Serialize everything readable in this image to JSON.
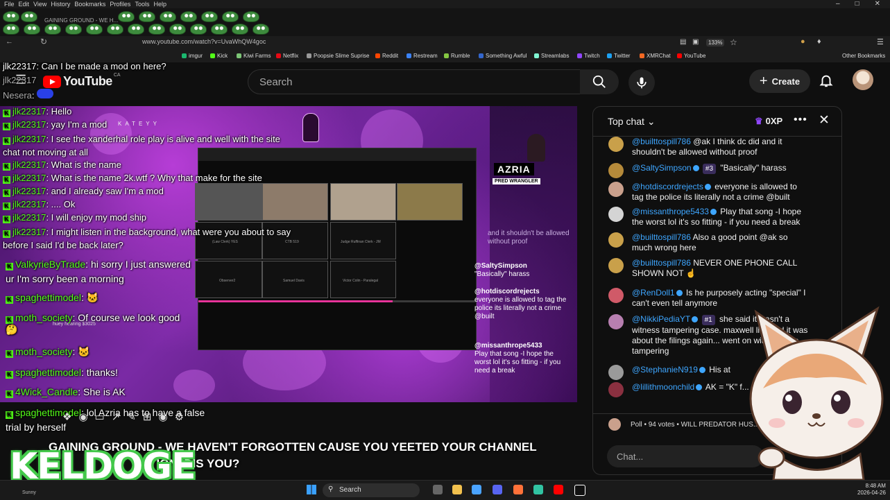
{
  "menubar": {
    "items": [
      "File",
      "Edit",
      "View",
      "History",
      "Bookmarks",
      "Profiles",
      "Tools",
      "Help"
    ]
  },
  "tabs": {
    "tab_title": "GAINING GROUND - WE H..."
  },
  "urlbar": {
    "url": "www.youtube.com/watch?v=UvaWhQW4goc",
    "zoom": "133%"
  },
  "bookmarks": [
    {
      "label": "imgur",
      "color": "#1bb76e"
    },
    {
      "label": "Kick",
      "color": "#53fc18"
    },
    {
      "label": "Kiwi Farms",
      "color": "#7cc576"
    },
    {
      "label": "Netflix",
      "color": "#e50914"
    },
    {
      "label": "Poopsie Slime Suprise",
      "color": "#999999"
    },
    {
      "label": "Reddit",
      "color": "#ff4500"
    },
    {
      "label": "Restream",
      "color": "#3b82f6"
    },
    {
      "label": "Rumble",
      "color": "#85c742"
    },
    {
      "label": "Something Awful",
      "color": "#3366cc"
    },
    {
      "label": "Streamlabs",
      "color": "#80f5d2"
    },
    {
      "label": "Twitch",
      "color": "#9146ff"
    },
    {
      "label": "Twitter",
      "color": "#1da1f2"
    },
    {
      "label": "XMRChat",
      "color": "#f26822"
    },
    {
      "label": "YouTube",
      "color": "#ff0000"
    }
  ],
  "other_bookmarks": "Other Bookmarks",
  "youtube": {
    "logo_text": "YouTube",
    "country": "CA",
    "search_placeholder": "Search",
    "create_label": "Create"
  },
  "video": {
    "azria": "AZRIA",
    "pred_tag": "PRED WRANGLER",
    "stream_title_fragment": "KATEYY",
    "mini_chat": [
      {
        "text": "and it shouldn't be allowed without proof"
      },
      {
        "author": "@SaltySimpson",
        "text": "\"Basically\" harass"
      },
      {
        "author": "@hotdiscordrejects",
        "text": "everyone is allowed to tag the police its literally not a crime @built"
      },
      {
        "author": "@missanthrope5433",
        "text": "Play that song -I hope the worst lol it's so fitting - if you need a break"
      }
    ],
    "thumb_labels": [
      "(Law Clerk) YES",
      "CTB 519",
      "Judge Ruffinan Clerk - JM",
      "Observer2",
      "Samuel Davis",
      "Victor Colin - Paralegal"
    ],
    "inner_overlay": "huey hearing $3025"
  },
  "overlay_chat": [
    {
      "user": "jlk22317",
      "text": "Can I be made a mod on here?"
    },
    {
      "user": "jlk22317",
      "text": ""
    },
    {
      "user": "Nesera",
      "text": ""
    },
    {
      "user": "jlk22317",
      "text": "Hello"
    },
    {
      "user": "jlk22317",
      "text": "yay I'm a mod"
    },
    {
      "user": "jlk22317",
      "text": "I see the xanderhal role play is alive and well with the site chat not moving at all"
    },
    {
      "user": "jlk22317",
      "text": "What is the name"
    },
    {
      "user": "jlk22317",
      "text": "What is the name 2k.wtf ? Why that make for the site"
    },
    {
      "user": "jlk22317",
      "text": "and I already saw I'm a mod"
    },
    {
      "user": "jlk22317",
      "text": ".... Ok"
    },
    {
      "user": "jlk22317",
      "text": "I will enjoy my mod ship"
    },
    {
      "user": "jlk22317",
      "text": "I might listen in the background, what were you about to say before I said I'd be back later?"
    }
  ],
  "overlay_chat_big": [
    {
      "user": "ValkyrieByTrade",
      "text": "hi sorry I just answered ur I'm sorry been a morning"
    },
    {
      "user": "spaghettimodel",
      "text": ""
    },
    {
      "user": "moth_society",
      "text": "Of course we look good"
    },
    {
      "user": "moth_society",
      "text": ""
    },
    {
      "user": "spaghettimodel",
      "text": "thanks!"
    },
    {
      "user": "4Wick_Candle",
      "text": "She is AK"
    },
    {
      "user": "spaghettimodel",
      "text": "lol Azria has to have a false trial by herself"
    }
  ],
  "banner": {
    "line1": "GAINING GROUND - WE HAVEN'T FORGOTTEN CAUSE YOU YEETED YOUR CHANNEL",
    "line2": "MATION, DIS YOU?"
  },
  "keldoge": "KELDOGE",
  "chat": {
    "header": "Top chat",
    "xp": "0XP",
    "messages": [
      {
        "author": "@builttospill786",
        "text": "@ak I think dc did and it shouldn't be allowed without proof",
        "avatar": "#c9a04a"
      },
      {
        "author": "@SaltySimpson",
        "rank": "#3",
        "text": "\"Basically\" harass",
        "avatar": "#b58a3a"
      },
      {
        "author": "@hotdiscordrejects",
        "text": "everyone is allowed to tag the police its literally not a crime @built",
        "avatar": "#caa08c"
      },
      {
        "author": "@missanthrope5433",
        "text": "Play that song -I hope the worst lol it's so fitting - if you need a break",
        "avatar": "#d4d4d4"
      },
      {
        "author": "@builttospill786",
        "text": "Also a good point @ak so much wrong here",
        "avatar": "#c9a04a"
      },
      {
        "author": "@builttospill786",
        "text": "NEVER ONE PHONE CALL SHOWN NOT ☝",
        "avatar": "#c9a04a"
      },
      {
        "author": "@RenDoll1",
        "text": "Is he purposely acting \"special\" I can't even tell anymore",
        "avatar": "#d05a68"
      },
      {
        "author": "@NikkiPediaYT",
        "rank": "#1",
        "text": "she said it wasn't a witness tampering case. maxwell li... said it was about the filings again... went on with witness tampering",
        "avatar": "#b77fb0"
      },
      {
        "author": "@StephanieN919",
        "text": "His at",
        "avatar": "#9a9a9a"
      },
      {
        "author": "@lillithmoonchild",
        "text": "AK = \"K\" f... 😭",
        "avatar": "#8a3040"
      }
    ],
    "poll": "Poll • 94 votes • WILL PREDATOR HUS...",
    "input_placeholder": "Chat..."
  },
  "taskbar": {
    "weather": "Sunny",
    "search": "Search",
    "time": "8:48 AM",
    "date": "2026-04-26"
  }
}
